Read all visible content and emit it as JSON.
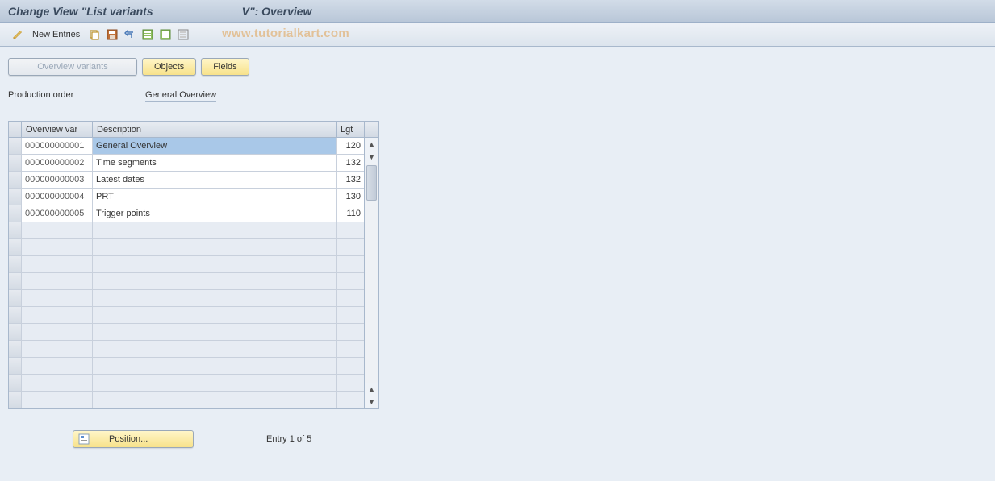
{
  "title": {
    "part1": "Change View \"List variants",
    "part2": "V\": Overview"
  },
  "toolbar": {
    "new_entries": "New Entries"
  },
  "watermark": "www.tutorialkart.com",
  "buttons": {
    "overview_variants": "Overview variants",
    "objects": "Objects",
    "fields": "Fields"
  },
  "meta": {
    "label": "Production order",
    "value": "General Overview"
  },
  "table": {
    "headers": {
      "c1": "Overview var",
      "c2": "Description",
      "c3": "Lgt"
    },
    "rows": [
      {
        "var": "000000000001",
        "desc": "General Overview",
        "lgt": "120",
        "highlight": true
      },
      {
        "var": "000000000002",
        "desc": "Time segments",
        "lgt": "132"
      },
      {
        "var": "000000000003",
        "desc": "Latest dates",
        "lgt": "132"
      },
      {
        "var": "000000000004",
        "desc": "PRT",
        "lgt": "130"
      },
      {
        "var": "000000000005",
        "desc": "Trigger points",
        "lgt": "110"
      }
    ],
    "empty_rows": 11
  },
  "footer": {
    "position": "Position...",
    "status": "Entry 1 of 5"
  }
}
